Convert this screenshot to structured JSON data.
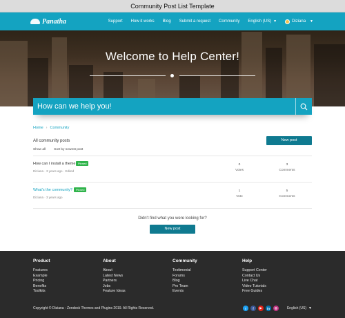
{
  "window": {
    "title": "Community Post List Template"
  },
  "navbar": {
    "logo_text": "Panatha",
    "links": [
      "Support",
      "How it works",
      "Blog",
      "Submit a request",
      "Community"
    ],
    "language": "English (US)",
    "user": "Diziana",
    "color": "#14a3c1"
  },
  "hero": {
    "title": "Welcome to Help Center!"
  },
  "search": {
    "placeholder": "How can we help you!"
  },
  "breadcrumb": {
    "home": "Home",
    "current": "Community"
  },
  "posts": {
    "title": "All community posts",
    "new_post": "New post",
    "filters": [
      "Show all",
      "Sort by newest post"
    ],
    "items": [
      {
        "title": "How can I install a theme",
        "badge": "Pinned",
        "author": "Diziana",
        "age": "3 years ago",
        "edited": "Edited",
        "votes": "0",
        "votes_label": "Votes",
        "comments": "3",
        "comments_label": "Comments"
      },
      {
        "title": "What's the community?",
        "badge": "Pinned",
        "author": "Diziana",
        "age": "3 years ago",
        "edited": "",
        "votes": "1",
        "votes_label": "Vote",
        "comments": "5",
        "comments_label": "Comments"
      }
    ]
  },
  "cta": {
    "text": "Didn't find what you were looking for?",
    "button": "New post"
  },
  "footer": {
    "columns": [
      {
        "title": "Product",
        "items": [
          "Features",
          "Example",
          "Pricing",
          "Benefits",
          "Toolkits"
        ]
      },
      {
        "title": "About",
        "items": [
          "About",
          "Latest News",
          "Partners",
          "Jobs",
          "Feature Ideas"
        ]
      },
      {
        "title": "Community",
        "items": [
          "Testimonial",
          "Forums",
          "Blog",
          "Pro Team",
          "Events"
        ]
      },
      {
        "title": "Help",
        "items": [
          "Support Center",
          "Contact Us",
          "Live Chat",
          "Video Tutorials",
          "Free Guides"
        ]
      }
    ],
    "copyright": "Copyright © Diziana - Zendesk Themes and Plugins 2019. All Rights Reserved.",
    "socials": [
      {
        "name": "twitter-icon",
        "glyph": "t",
        "color": "#1da1f2"
      },
      {
        "name": "facebook-icon",
        "glyph": "f",
        "color": "#3b5998"
      },
      {
        "name": "youtube-icon",
        "glyph": "▶",
        "color": "#e62117"
      },
      {
        "name": "linkedin-icon",
        "glyph": "in",
        "color": "#0077b5"
      },
      {
        "name": "instagram-icon",
        "glyph": "◎",
        "color": "#c13584"
      }
    ],
    "language": "English (US)"
  }
}
